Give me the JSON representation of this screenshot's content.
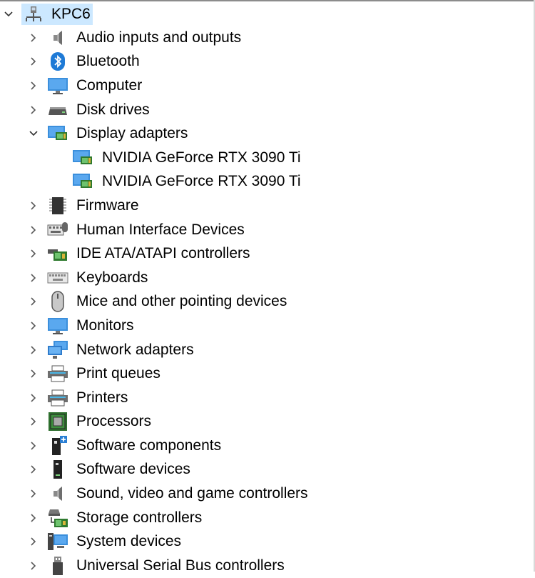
{
  "tree": {
    "root": {
      "label": "KPC6",
      "expanded": true,
      "icon": "computer-network-icon"
    },
    "categories": [
      {
        "label": "Audio inputs and outputs",
        "icon": "speaker-icon",
        "expanded": false
      },
      {
        "label": "Bluetooth",
        "icon": "bluetooth-icon",
        "expanded": false
      },
      {
        "label": "Computer",
        "icon": "monitor-icon",
        "expanded": false
      },
      {
        "label": "Disk drives",
        "icon": "disk-drive-icon",
        "expanded": false
      },
      {
        "label": "Display adapters",
        "icon": "display-adapter-icon",
        "expanded": true,
        "children": [
          {
            "label": "NVIDIA GeForce RTX 3090 Ti",
            "icon": "display-adapter-icon"
          },
          {
            "label": "NVIDIA GeForce RTX 3090 Ti",
            "icon": "display-adapter-icon"
          }
        ]
      },
      {
        "label": "Firmware",
        "icon": "chip-icon",
        "expanded": false
      },
      {
        "label": "Human Interface Devices",
        "icon": "hid-icon",
        "expanded": false
      },
      {
        "label": "IDE ATA/ATAPI controllers",
        "icon": "controller-card-icon",
        "expanded": false
      },
      {
        "label": "Keyboards",
        "icon": "keyboard-icon",
        "expanded": false
      },
      {
        "label": "Mice and other pointing devices",
        "icon": "mouse-icon",
        "expanded": false
      },
      {
        "label": "Monitors",
        "icon": "monitor-icon",
        "expanded": false
      },
      {
        "label": "Network adapters",
        "icon": "network-adapter-icon",
        "expanded": false
      },
      {
        "label": "Print queues",
        "icon": "printer-icon",
        "expanded": false
      },
      {
        "label": "Printers",
        "icon": "printer-icon",
        "expanded": false
      },
      {
        "label": "Processors",
        "icon": "processor-icon",
        "expanded": false
      },
      {
        "label": "Software components",
        "icon": "software-component-icon",
        "expanded": false
      },
      {
        "label": "Software devices",
        "icon": "software-device-icon",
        "expanded": false
      },
      {
        "label": "Sound, video and game controllers",
        "icon": "speaker-icon",
        "expanded": false
      },
      {
        "label": "Storage controllers",
        "icon": "storage-controller-icon",
        "expanded": false
      },
      {
        "label": "System devices",
        "icon": "system-devices-icon",
        "expanded": false
      },
      {
        "label": "Universal Serial Bus controllers",
        "icon": "usb-icon",
        "expanded": false
      }
    ]
  },
  "colors": {
    "selection": "#cce8ff",
    "chevron": "#5a5a5a",
    "accent": "#2a7fd4"
  }
}
